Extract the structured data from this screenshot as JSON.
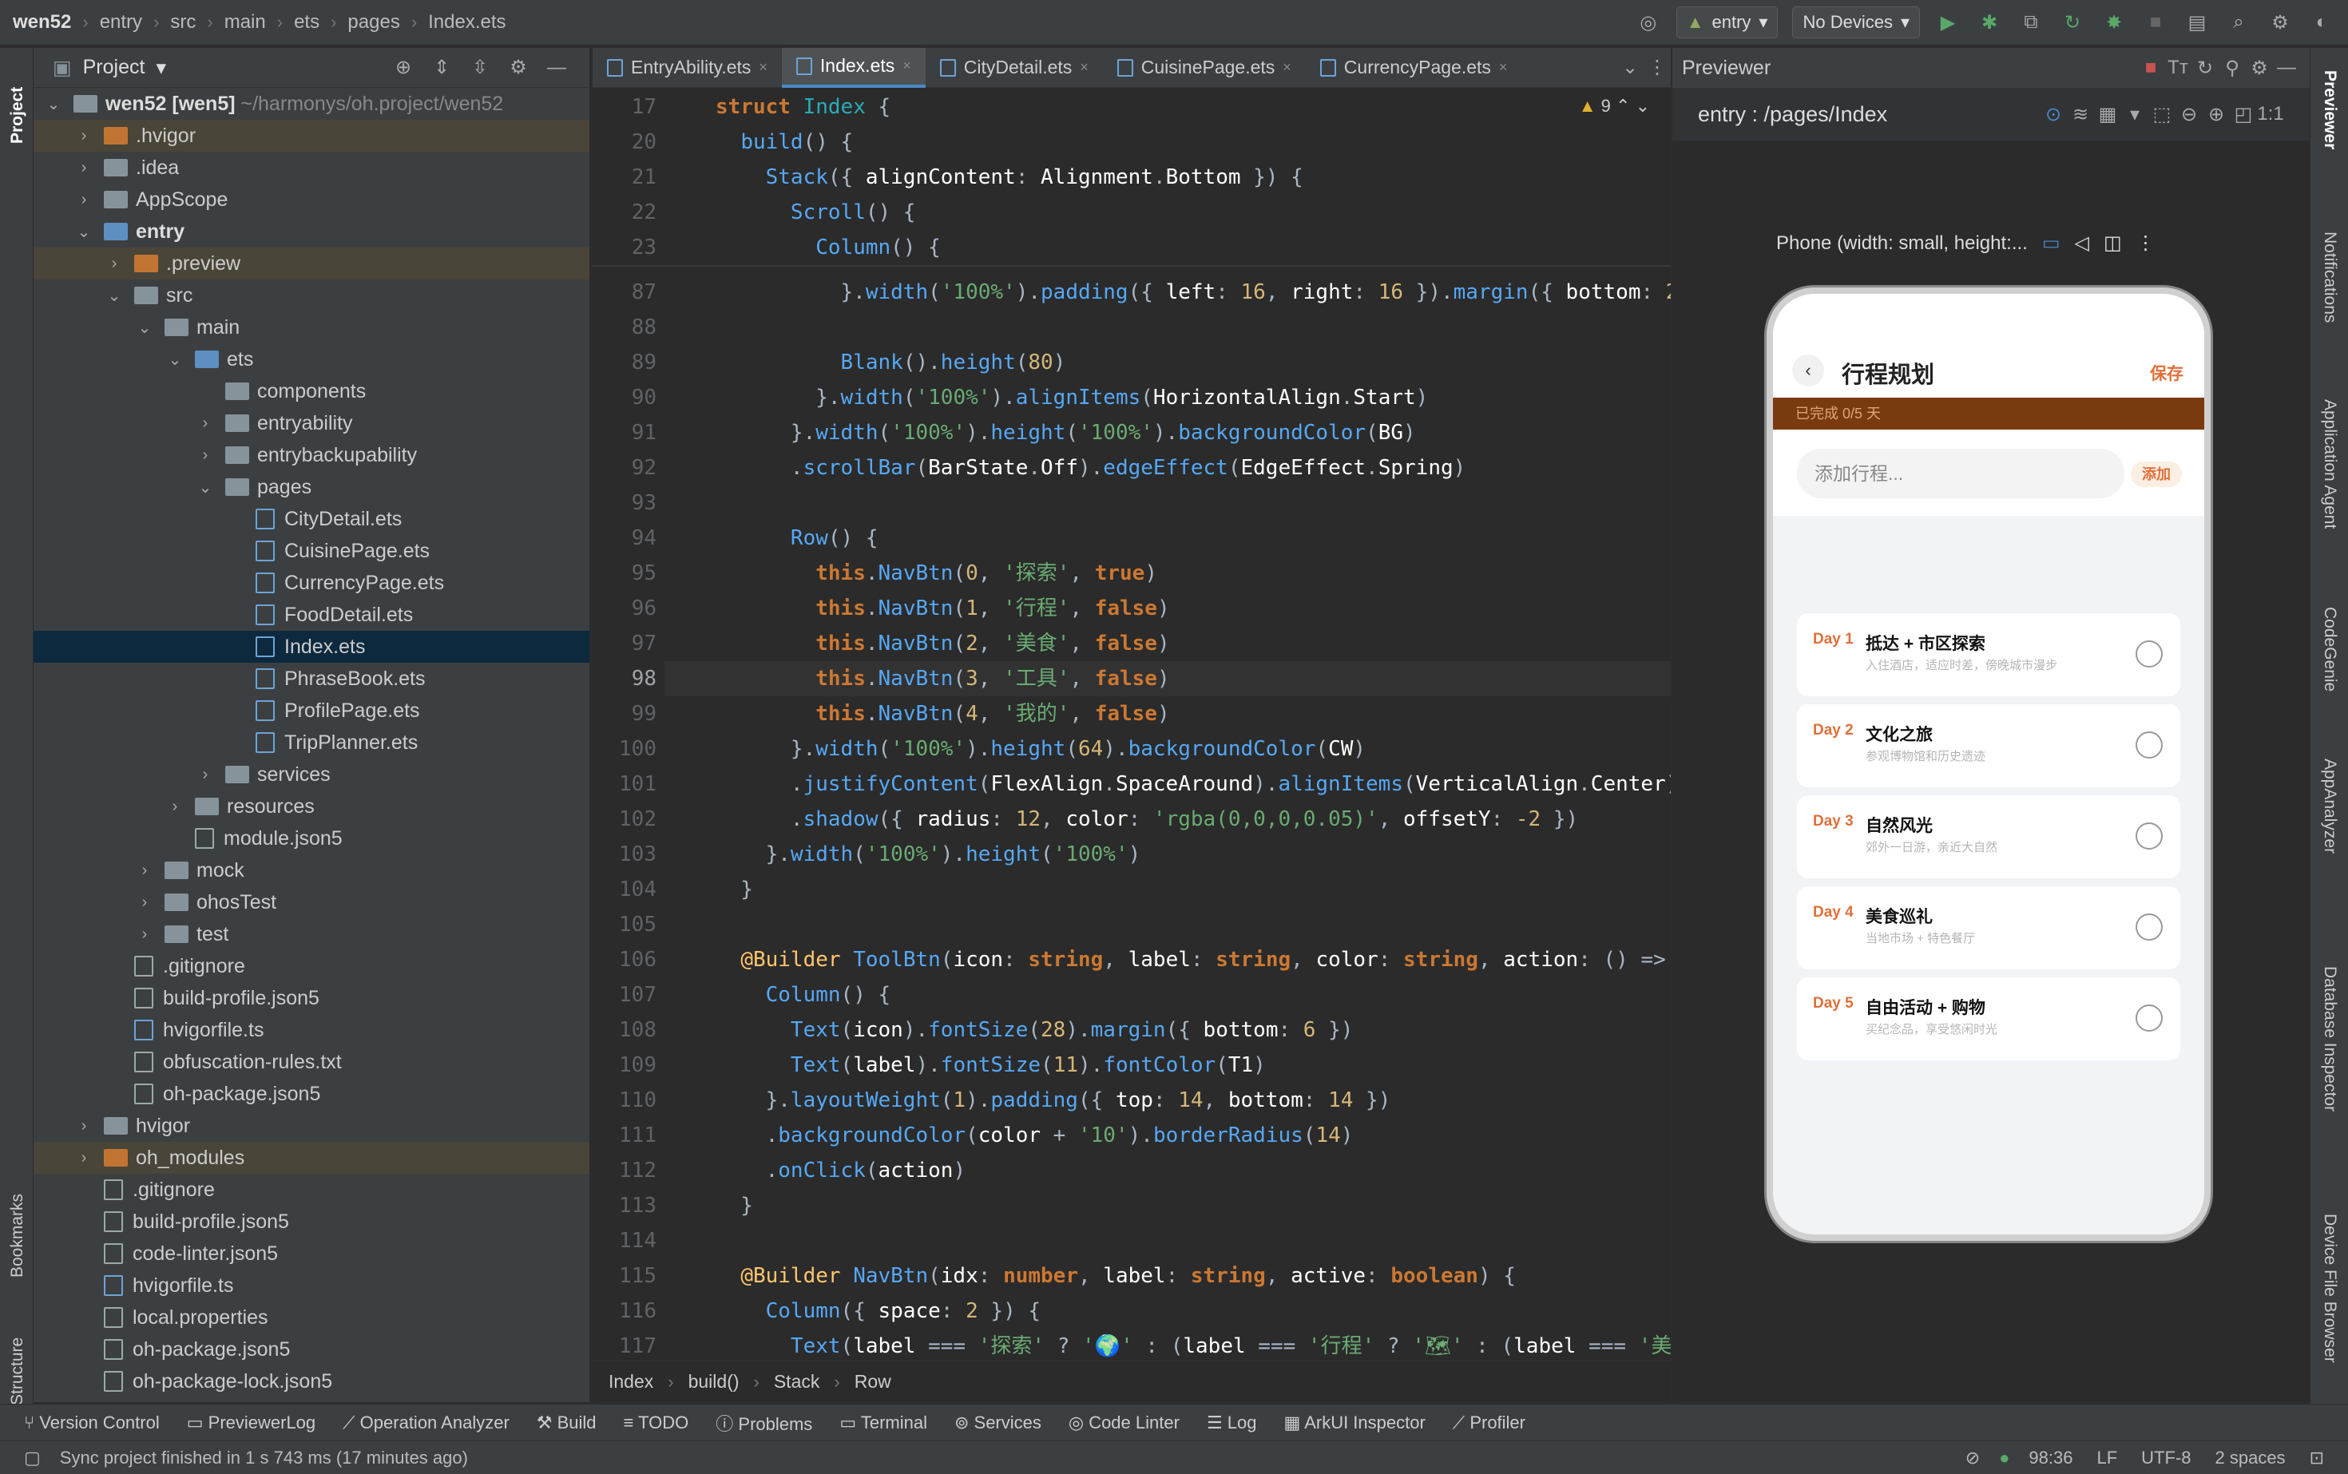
{
  "titlebar": {
    "crumbs": [
      "wen52",
      "entry",
      "src",
      "main",
      "ets",
      "pages",
      "Index.ets"
    ],
    "run_config": "entry",
    "device": "No Devices"
  },
  "project": {
    "title": "Project",
    "tree": [
      {
        "label": ".hvigor",
        "depth": 1,
        "type": "folder-or",
        "chev": ">",
        "state": "hl"
      },
      {
        "label": ".idea",
        "depth": 1,
        "type": "folder",
        "chev": ">"
      },
      {
        "label": "AppScope",
        "depth": 1,
        "type": "folder",
        "chev": ">"
      },
      {
        "label": "entry",
        "depth": 1,
        "type": "folder-bl",
        "chev": "v",
        "bold": true
      },
      {
        "label": ".preview",
        "depth": 2,
        "type": "folder-or",
        "chev": ">",
        "state": "hl"
      },
      {
        "label": "src",
        "depth": 2,
        "type": "folder",
        "chev": "v"
      },
      {
        "label": "main",
        "depth": 3,
        "type": "folder",
        "chev": "v"
      },
      {
        "label": "ets",
        "depth": 4,
        "type": "folder-bl",
        "chev": "v"
      },
      {
        "label": "components",
        "depth": 5,
        "type": "folder",
        "chev": ""
      },
      {
        "label": "entryability",
        "depth": 5,
        "type": "folder",
        "chev": ">"
      },
      {
        "label": "entrybackupability",
        "depth": 5,
        "type": "folder",
        "chev": ">"
      },
      {
        "label": "pages",
        "depth": 5,
        "type": "folder",
        "chev": "v"
      },
      {
        "label": "CityDetail.ets",
        "depth": 6,
        "type": "ets",
        "chev": ""
      },
      {
        "label": "CuisinePage.ets",
        "depth": 6,
        "type": "ets",
        "chev": ""
      },
      {
        "label": "CurrencyPage.ets",
        "depth": 6,
        "type": "ets",
        "chev": ""
      },
      {
        "label": "FoodDetail.ets",
        "depth": 6,
        "type": "ets",
        "chev": ""
      },
      {
        "label": "Index.ets",
        "depth": 6,
        "type": "ets",
        "chev": "",
        "state": "sel"
      },
      {
        "label": "PhraseBook.ets",
        "depth": 6,
        "type": "ets",
        "chev": ""
      },
      {
        "label": "ProfilePage.ets",
        "depth": 6,
        "type": "ets",
        "chev": ""
      },
      {
        "label": "TripPlanner.ets",
        "depth": 6,
        "type": "ets",
        "chev": ""
      },
      {
        "label": "services",
        "depth": 5,
        "type": "folder",
        "chev": ">"
      },
      {
        "label": "resources",
        "depth": 4,
        "type": "folder",
        "chev": ">"
      },
      {
        "label": "module.json5",
        "depth": 4,
        "type": "js",
        "chev": ""
      },
      {
        "label": "mock",
        "depth": 3,
        "type": "folder",
        "chev": ">"
      },
      {
        "label": "ohosTest",
        "depth": 3,
        "type": "folder",
        "chev": ">"
      },
      {
        "label": "test",
        "depth": 3,
        "type": "folder",
        "chev": ">"
      },
      {
        "label": ".gitignore",
        "depth": 2,
        "type": "js",
        "chev": ""
      },
      {
        "label": "build-profile.json5",
        "depth": 2,
        "type": "js",
        "chev": ""
      },
      {
        "label": "hvigorfile.ts",
        "depth": 2,
        "type": "ets",
        "chev": ""
      },
      {
        "label": "obfuscation-rules.txt",
        "depth": 2,
        "type": "js",
        "chev": ""
      },
      {
        "label": "oh-package.json5",
        "depth": 2,
        "type": "js",
        "chev": ""
      },
      {
        "label": "hvigor",
        "depth": 1,
        "type": "folder",
        "chev": ">"
      },
      {
        "label": "oh_modules",
        "depth": 1,
        "type": "folder-or",
        "chev": ">",
        "state": "hl"
      },
      {
        "label": ".gitignore",
        "depth": 1,
        "type": "js",
        "chev": ""
      },
      {
        "label": "build-profile.json5",
        "depth": 1,
        "type": "js",
        "chev": ""
      },
      {
        "label": "code-linter.json5",
        "depth": 1,
        "type": "js",
        "chev": ""
      },
      {
        "label": "hvigorfile.ts",
        "depth": 1,
        "type": "ets",
        "chev": ""
      },
      {
        "label": "local.properties",
        "depth": 1,
        "type": "js",
        "chev": ""
      },
      {
        "label": "oh-package.json5",
        "depth": 1,
        "type": "js",
        "chev": ""
      },
      {
        "label": "oh-package-lock.json5",
        "depth": 1,
        "type": "js",
        "chev": ""
      }
    ],
    "root": {
      "name": "wen52 [wen5]",
      "path": "~/harmonys/oh.project/wen52"
    }
  },
  "tabs": [
    "EntryAbility.ets",
    "Index.ets",
    "CityDetail.ets",
    "CuisinePage.ets",
    "CurrencyPage.ets"
  ],
  "editor": {
    "warnings": "9",
    "lines": [
      {
        "n": "17",
        "c": "<span class='k'>struct</span> <span class='n'>Index</span> {"
      },
      {
        "n": "20",
        "c": "  <span class='fn'>build</span>() {"
      },
      {
        "n": "21",
        "c": "    <span class='fn'>Stack</span>({ <span class='t'>alignContent</span>: <span class='t'>Alignment</span>.<span class='t'>Bottom</span> }) {"
      },
      {
        "n": "22",
        "c": "      <span class='fn'>Scroll</span>() {"
      },
      {
        "n": "23",
        "c": "        <span class='fn'>Column</span>() {"
      },
      {
        "n": "87",
        "c": "          }.<span class='fn'>width</span>(<span class='s'>'100%'</span>).<span class='fn'>padding</span>({ <span class='t'>left</span>: <span class='p'>16</span>, <span class='t'>right</span>: <span class='p'>16</span> }).<span class='fn'>margin</span>({ <span class='t'>bottom</span>: <span class='p'>2</span>"
      },
      {
        "n": "88",
        "c": ""
      },
      {
        "n": "89",
        "c": "          <span class='fn'>Blank</span>().<span class='fn'>height</span>(<span class='p'>80</span>)"
      },
      {
        "n": "90",
        "c": "        }.<span class='fn'>width</span>(<span class='s'>'100%'</span>).<span class='fn'>alignItems</span>(<span class='t'>HorizontalAlign</span>.<span class='t'>Start</span>)"
      },
      {
        "n": "91",
        "c": "      }.<span class='fn'>width</span>(<span class='s'>'100%'</span>).<span class='fn'>height</span>(<span class='s'>'100%'</span>).<span class='fn'>backgroundColor</span>(<span class='t'>BG</span>)"
      },
      {
        "n": "92",
        "c": "      .<span class='fn'>scrollBar</span>(<span class='t'>BarState</span>.<span class='t'>Off</span>).<span class='fn'>edgeEffect</span>(<span class='t'>EdgeEffect</span>.<span class='t'>Spring</span>)"
      },
      {
        "n": "93",
        "c": ""
      },
      {
        "n": "94",
        "c": "      <span class='fn'>Row</span>() {"
      },
      {
        "n": "95",
        "c": "        <span class='k'>this</span>.<span class='fn'>NavBtn</span>(<span class='p'>0</span>, <span class='s'>'探索'</span>, <span class='k'>true</span>)"
      },
      {
        "n": "96",
        "c": "        <span class='k'>this</span>.<span class='fn'>NavBtn</span>(<span class='p'>1</span>, <span class='s'>'行程'</span>, <span class='k'>false</span>)"
      },
      {
        "n": "97",
        "c": "        <span class='k'>this</span>.<span class='fn'>NavBtn</span>(<span class='p'>2</span>, <span class='s'>'美食'</span>, <span class='k'>false</span>)"
      },
      {
        "n": "98",
        "c": "        <span class='k'>this</span>.<span class='fn'>NavBtn</span>(<span class='p'>3</span>, <span class='s'>'工具'</span>, <span class='k'>false</span>)"
      },
      {
        "n": "99",
        "c": "        <span class='k'>this</span>.<span class='fn'>NavBtn</span>(<span class='p'>4</span>, <span class='s'>'我的'</span>, <span class='k'>false</span>)"
      },
      {
        "n": "100",
        "c": "      }.<span class='fn'>width</span>(<span class='s'>'100%'</span>).<span class='fn'>height</span>(<span class='p'>64</span>).<span class='fn'>backgroundColor</span>(<span class='t'>CW</span>)"
      },
      {
        "n": "101",
        "c": "      .<span class='fn'>justifyContent</span>(<span class='t'>FlexAlign</span>.<span class='t'>SpaceAround</span>).<span class='fn'>alignItems</span>(<span class='t'>VerticalAlign</span>.<span class='t'>Center</span>)"
      },
      {
        "n": "102",
        "c": "      .<span class='fn'>shadow</span>({ <span class='t'>radius</span>: <span class='p'>12</span>, <span class='t'>color</span>: <span class='s'>'rgba(0,0,0,0.05)'</span>, <span class='t'>offsetY</span>: <span class='p'>-2</span> })"
      },
      {
        "n": "103",
        "c": "    }.<span class='fn'>width</span>(<span class='s'>'100%'</span>).<span class='fn'>height</span>(<span class='s'>'100%'</span>)"
      },
      {
        "n": "104",
        "c": "  }"
      },
      {
        "n": "105",
        "c": ""
      },
      {
        "n": "106",
        "c": "  <span class='kw'>@Builder</span> <span class='fn'>ToolBtn</span>(<span class='t'>icon</span>: <span class='k'>string</span>, <span class='t'>label</span>: <span class='k'>string</span>, <span class='t'>color</span>: <span class='k'>string</span>, <span class='t'>action</span>: () =>"
      },
      {
        "n": "107",
        "c": "    <span class='fn'>Column</span>() {"
      },
      {
        "n": "108",
        "c": "      <span class='fn'>Text</span>(<span class='t'>icon</span>).<span class='fn'>fontSize</span>(<span class='p'>28</span>).<span class='fn'>margin</span>({ <span class='t'>bottom</span>: <span class='p'>6</span> })"
      },
      {
        "n": "109",
        "c": "      <span class='fn'>Text</span>(<span class='t'>label</span>).<span class='fn'>fontSize</span>(<span class='p'>11</span>).<span class='fn'>fontColor</span>(<span class='t'>T1</span>)"
      },
      {
        "n": "110",
        "c": "    }.<span class='fn'>layoutWeight</span>(<span class='p'>1</span>).<span class='fn'>padding</span>({ <span class='t'>top</span>: <span class='p'>14</span>, <span class='t'>bottom</span>: <span class='p'>14</span> })"
      },
      {
        "n": "111",
        "c": "    .<span class='fn'>backgroundColor</span>(<span class='t'>color</span> + <span class='s'>'10'</span>).<span class='fn'>borderRadius</span>(<span class='p'>14</span>)"
      },
      {
        "n": "112",
        "c": "    .<span class='fn'>onClick</span>(<span class='t'>action</span>)"
      },
      {
        "n": "113",
        "c": "  }"
      },
      {
        "n": "114",
        "c": ""
      },
      {
        "n": "115",
        "c": "  <span class='kw'>@Builder</span> <span class='fn'>NavBtn</span>(<span class='t'>idx</span>: <span class='k'>number</span>, <span class='t'>label</span>: <span class='k'>string</span>, <span class='t'>active</span>: <span class='k'>boolean</span>) {"
      },
      {
        "n": "116",
        "c": "    <span class='fn'>Column</span>({ <span class='t'>space</span>: <span class='p'>2</span> }) {"
      },
      {
        "n": "117",
        "c": "      <span class='fn'>Text</span>(<span class='t'>label</span> === <span class='s'>'探索'</span> ? <span class='s'>'🌍'</span> : (<span class='t'>label</span> === <span class='s'>'行程'</span> ? <span class='s'>'🗺'</span> : (<span class='t'>label</span> === <span class='s'>'美"
      }
    ],
    "breadcrumb": [
      "Index",
      "build()",
      "Stack",
      "Row"
    ]
  },
  "previewer": {
    "title": "Previewer",
    "path": "entry : /pages/Index",
    "phone_label": "Phone (width: small, height:...",
    "app": {
      "title": "行程规划",
      "save": "保存",
      "progress": "已完成 0/5 天",
      "placeholder": "添加行程...",
      "add": "添加",
      "days": [
        {
          "label": "Day 1",
          "title": "抵达 + 市区探索",
          "sub": "入住酒店，适应时差，傍晚城市漫步"
        },
        {
          "label": "Day 2",
          "title": "文化之旅",
          "sub": "参观博物馆和历史遗迹"
        },
        {
          "label": "Day 3",
          "title": "自然风光",
          "sub": "郊外一日游，亲近大自然"
        },
        {
          "label": "Day 4",
          "title": "美食巡礼",
          "sub": "当地市场 + 特色餐厅"
        },
        {
          "label": "Day 5",
          "title": "自由活动 + 购物",
          "sub": "买纪念品，享受悠闲时光"
        }
      ]
    }
  },
  "left_strip": [
    "Project",
    "Bookmarks",
    "Structure"
  ],
  "right_strip": [
    "Previewer",
    "Notifications",
    "Application Agent",
    "CodeGenie",
    "AppAnalyzer",
    "Database Inspector",
    "Device File Browser"
  ],
  "toolwindows": [
    "Version Control",
    "PreviewerLog",
    "Operation Analyzer",
    "Build",
    "TODO",
    "Problems",
    "Terminal",
    "Services",
    "Code Linter",
    "Log",
    "ArkUI Inspector",
    "Profiler"
  ],
  "status": {
    "message": "Sync project finished in 1 s 743 ms (17 minutes ago)",
    "position": "98:36",
    "line_sep": "LF",
    "encoding": "UTF-8",
    "indent": "2 spaces"
  }
}
